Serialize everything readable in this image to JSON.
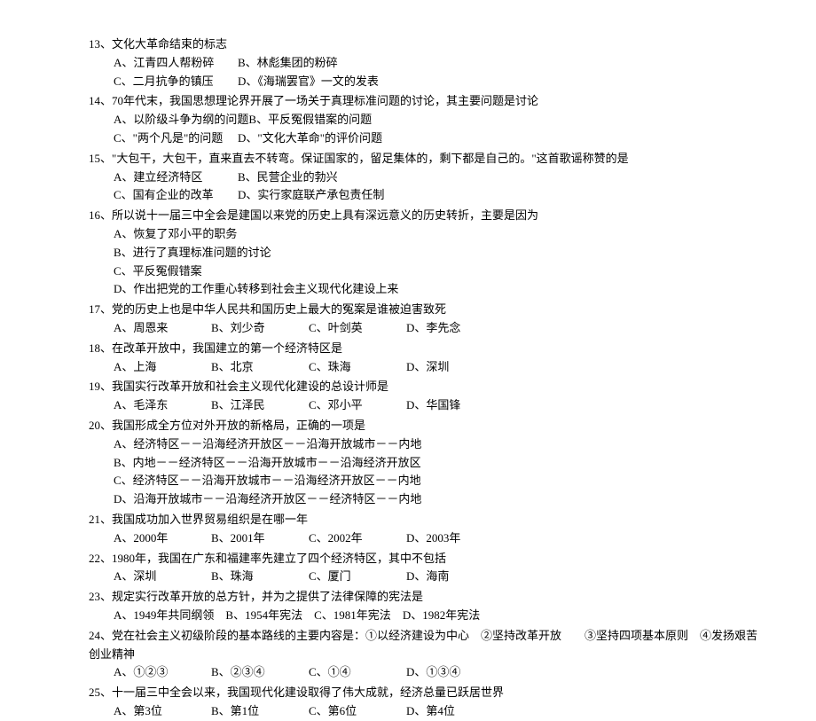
{
  "questions": [
    {
      "num": "13、",
      "stem": "文化大革命结束的标志",
      "rows": [
        [
          {
            "label": "A、",
            "text": "江青四人帮粉碎",
            "cls": "w-a"
          },
          {
            "label": "B、",
            "text": "林彪集团的粉碎",
            "cls": "w-b"
          }
        ],
        [
          {
            "label": "C、",
            "text": "二月抗争的镇压",
            "cls": "w-c"
          },
          {
            "label": "D、",
            "text": "《海瑞罢官》一文的发表",
            "cls": "w-d"
          }
        ]
      ]
    },
    {
      "num": "14、",
      "stem": "70年代末，我国思想理论界开展了一场关于真理标准问题的讨论，其主要问题是讨论",
      "rows": [
        [
          {
            "label": "A、",
            "text": "以阶级斗争为纲的问题",
            "cls": "w-a"
          },
          {
            "label": "B、",
            "text": "平反冤假错案的问题",
            "cls": "w-b"
          }
        ],
        [
          {
            "label": "C、",
            "text": "\"两个凡是\"的问题",
            "cls": "w-c"
          },
          {
            "label": "D、",
            "text": "\"文化大革命\"的评价问题",
            "cls": "w-d"
          }
        ]
      ]
    },
    {
      "num": "15、",
      "stem": "\"大包干，大包干，直来直去不转弯。保证国家的，留足集体的，剩下都是自己的。\"这首歌谣称赞的是",
      "rows": [
        [
          {
            "label": "A、",
            "text": "建立经济特区",
            "cls": "w-a"
          },
          {
            "label": "B、",
            "text": "民营企业的勃兴",
            "cls": "w-b"
          }
        ],
        [
          {
            "label": "C、",
            "text": "国有企业的改革",
            "cls": "w-c"
          },
          {
            "label": "D、",
            "text": "实行家庭联产承包责任制",
            "cls": "w-d"
          }
        ]
      ]
    },
    {
      "num": "16、",
      "stem": "所以说十一届三中全会是建国以来党的历史上具有深远意义的历史转折，主要是因为",
      "rows": [
        [
          {
            "label": "A、",
            "text": "恢复了邓小平的职务",
            "cls": ""
          }
        ],
        [
          {
            "label": "B、",
            "text": "进行了真理标准问题的讨论",
            "cls": ""
          }
        ],
        [
          {
            "label": "C、",
            "text": "平反冤假错案",
            "cls": ""
          }
        ],
        [
          {
            "label": "D、",
            "text": "作出把党的工作重心转移到社会主义现代化建设上来",
            "cls": ""
          }
        ]
      ]
    },
    {
      "num": "17、",
      "stem": "党的历史上也是中华人民共和国历史上最大的冤案是谁被迫害致死",
      "rows": [
        [
          {
            "label": "A、",
            "text": "周恩来",
            "cls": "w-short-a"
          },
          {
            "label": "B、",
            "text": "刘少奇",
            "cls": "w-short-b"
          },
          {
            "label": "C、",
            "text": "叶剑英",
            "cls": "w-short-c"
          },
          {
            "label": "D、",
            "text": "李先念",
            "cls": "w-short-d"
          }
        ]
      ]
    },
    {
      "num": "18、",
      "stem": "在改革开放中，我国建立的第一个经济特区是",
      "rows": [
        [
          {
            "label": "A、",
            "text": "上海",
            "cls": "w-short-a"
          },
          {
            "label": "B、",
            "text": "北京",
            "cls": "w-short-b"
          },
          {
            "label": "C、",
            "text": "珠海",
            "cls": "w-short-c"
          },
          {
            "label": "D、",
            "text": "深圳",
            "cls": "w-short-d"
          }
        ]
      ]
    },
    {
      "num": "19、",
      "stem": "我国实行改革开放和社会主义现代化建设的总设计师是",
      "rows": [
        [
          {
            "label": "A、",
            "text": "毛泽东",
            "cls": "w-short-a"
          },
          {
            "label": "B、",
            "text": "江泽民",
            "cls": "w-short-b"
          },
          {
            "label": "C、",
            "text": "邓小平",
            "cls": "w-short-c"
          },
          {
            "label": "D、",
            "text": "华国锋",
            "cls": "w-short-d"
          }
        ]
      ]
    },
    {
      "num": "20、",
      "stem": "我国形成全方位对外开放的新格局，正确的一项是",
      "rows": [
        [
          {
            "label": "A、",
            "text": "经济特区－－沿海经济开放区－－沿海开放城市－－内地",
            "cls": ""
          }
        ],
        [
          {
            "label": "B、",
            "text": "内地－－经济特区－－沿海开放城市－－沿海经济开放区",
            "cls": ""
          }
        ],
        [
          {
            "label": "C、",
            "text": "经济特区－－沿海开放城市－－沿海经济开放区－－内地",
            "cls": ""
          }
        ],
        [
          {
            "label": "D、",
            "text": "沿海开放城市－－沿海经济开放区－－经济特区－－内地",
            "cls": ""
          }
        ]
      ]
    },
    {
      "num": "21、",
      "stem": "我国成功加入世界贸易组织是在哪一年",
      "rows": [
        [
          {
            "label": "A、",
            "text": "2000年",
            "cls": "w-short-a"
          },
          {
            "label": "B、",
            "text": "2001年",
            "cls": "w-short-b"
          },
          {
            "label": "C、",
            "text": "2002年",
            "cls": "w-short-c"
          },
          {
            "label": "D、",
            "text": "2003年",
            "cls": "w-short-d"
          }
        ]
      ]
    },
    {
      "num": "22、",
      "stem": "1980年，我国在广东和福建率先建立了四个经济特区，其中不包括",
      "rows": [
        [
          {
            "label": "A、",
            "text": "深圳",
            "cls": "w-short-a"
          },
          {
            "label": "B、",
            "text": "珠海",
            "cls": "w-short-b"
          },
          {
            "label": "C、",
            "text": "厦门",
            "cls": "w-short-c"
          },
          {
            "label": "D、",
            "text": "海南",
            "cls": "w-short-d"
          }
        ]
      ]
    },
    {
      "num": "23、",
      "stem": "规定实行改革开放的总方针，并为之提供了法律保障的宪法是",
      "rows": [
        [
          {
            "label": "A、",
            "text": "1949年共同纲领",
            "cls": ""
          },
          {
            "label": "B、",
            "text": "1954年宪法",
            "cls": ""
          },
          {
            "label": "C、",
            "text": "1981年宪法",
            "cls": ""
          },
          {
            "label": "D、",
            "text": "1982年宪法",
            "cls": ""
          }
        ]
      ],
      "tight": true
    },
    {
      "num": "24、",
      "stem": "党在社会主义初级阶段的基本路线的主要内容是：①以经济建设为中心　②坚持改革开放　　③坚持四项基本原则　④发扬艰苦创业精神",
      "rows": [
        [
          {
            "label": "A、",
            "text": "①②③",
            "cls": "w-short-a"
          },
          {
            "label": "B、",
            "text": "②③④",
            "cls": "w-short-b"
          },
          {
            "label": "C、",
            "text": "①④",
            "cls": "w-short-c"
          },
          {
            "label": "D、",
            "text": "①③④",
            "cls": "w-short-d"
          }
        ]
      ]
    },
    {
      "num": "25、",
      "stem": "十一届三中全会以来，我国现代化建设取得了伟大成就，经济总量已跃居世界",
      "rows": [
        [
          {
            "label": "A、",
            "text": "第3位",
            "cls": "w-short-a"
          },
          {
            "label": "B、",
            "text": "第1位",
            "cls": "w-short-b"
          },
          {
            "label": "C、",
            "text": "第6位",
            "cls": "w-short-c"
          },
          {
            "label": "D、",
            "text": "第4位",
            "cls": "w-short-d"
          }
        ]
      ]
    }
  ]
}
